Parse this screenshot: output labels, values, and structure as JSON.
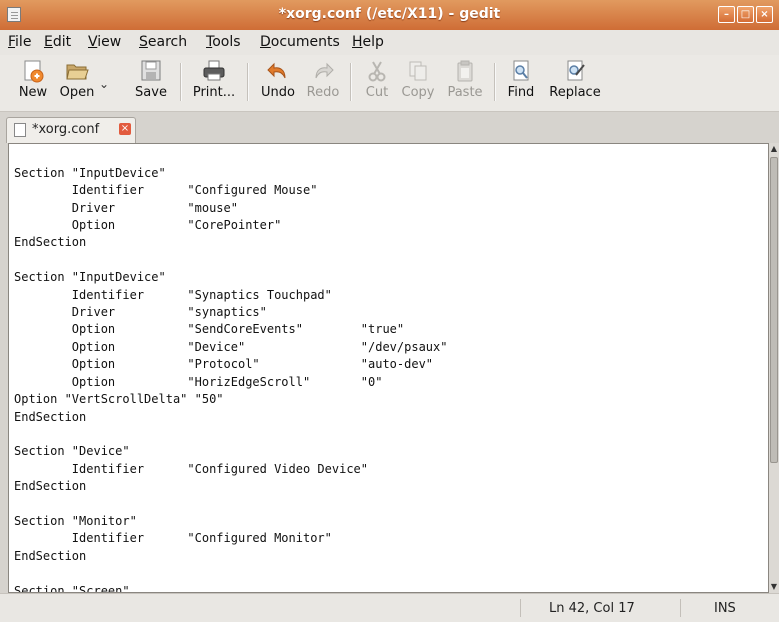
{
  "window": {
    "title": "*xorg.conf (/etc/X11) - gedit"
  },
  "menu": [
    {
      "label": "File",
      "key": "F",
      "rest": "ile"
    },
    {
      "label": "Edit",
      "key": "E",
      "rest": "dit"
    },
    {
      "label": "View",
      "key": "V",
      "rest": "iew"
    },
    {
      "label": "Search",
      "key": "S",
      "rest": "earch"
    },
    {
      "label": "Tools",
      "key": "T",
      "rest": "ools"
    },
    {
      "label": "Documents",
      "key": "D",
      "rest": "ocuments"
    },
    {
      "label": "Help",
      "key": "H",
      "rest": "elp"
    }
  ],
  "toolbar": {
    "new": "New",
    "open": "Open",
    "save": "Save",
    "print": "Print...",
    "undo": "Undo",
    "redo": "Redo",
    "cut": "Cut",
    "copy": "Copy",
    "paste": "Paste",
    "find": "Find",
    "replace": "Replace"
  },
  "tab": {
    "label": "*xorg.conf"
  },
  "editor": {
    "content": "EndSection\n\nSection \"InputDevice\"\n        Identifier      \"Configured Mouse\"\n        Driver          \"mouse\"\n        Option          \"CorePointer\"\nEndSection\n\nSection \"InputDevice\"\n        Identifier      \"Synaptics Touchpad\"\n        Driver          \"synaptics\"\n        Option          \"SendCoreEvents\"        \"true\"\n        Option          \"Device\"                \"/dev/psaux\"\n        Option          \"Protocol\"              \"auto-dev\"\n        Option          \"HorizEdgeScroll\"       \"0\"\nOption \"VertScrollDelta\" \"50\"\nEndSection\n\nSection \"Device\"\n        Identifier      \"Configured Video Device\"\nEndSection\n\nSection \"Monitor\"\n        Identifier      \"Configured Monitor\"\nEndSection\n\nSection \"Screen\""
  },
  "status": {
    "position": "Ln 42, Col 17",
    "mode": "INS"
  }
}
